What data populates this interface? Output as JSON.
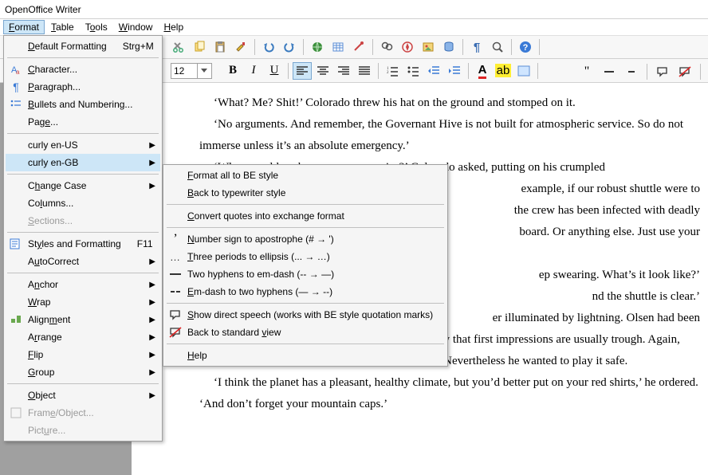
{
  "window": {
    "title": "OpenOffice Writer"
  },
  "menubar": {
    "format": "Format",
    "table": "Table",
    "tools": "Tools",
    "window": "Window",
    "help": "Help"
  },
  "format_bar": {
    "font_size": "12"
  },
  "format_menu": {
    "default_formatting": "Default Formatting",
    "default_formatting_sc": "Strg+M",
    "character": "Character...",
    "paragraph": "Paragraph...",
    "bullets": "Bullets and Numbering...",
    "page": "Page...",
    "curly_us": "curly en-US",
    "curly_gb": "curly en-GB",
    "change_case": "Change Case",
    "columns": "Columns...",
    "sections": "Sections...",
    "styles": "Styles and Formatting",
    "styles_sc": "F11",
    "autocorrect": "AutoCorrect",
    "anchor": "Anchor",
    "wrap": "Wrap",
    "alignment": "Alignment",
    "arrange": "Arrange",
    "flip": "Flip",
    "group": "Group",
    "object": "Object",
    "frame": "Frame/Object...",
    "picture": "Picture..."
  },
  "submenu": {
    "format_be": "Format all to BE style",
    "back_type": "Back to typewriter style",
    "convert_quotes": "Convert quotes into exchange format",
    "number_sign": "Number sign to apostrophe (# → ')",
    "three_periods": "Three periods to ellipsis (... → …)",
    "two_hyphens": "Two hyphens to em-dash (-- → —)",
    "em_to_hyph": "Em-dash to two hyphens (— → --)",
    "show_direct": "Show direct speech (works with BE style quotation marks)",
    "back_std": "Back to standard view",
    "help": "Help"
  },
  "document": {
    "p1": "‘What? Me? Shit!’ Colorado threw his hat on the ground and stomped on it.",
    "p2": "‘No arguments. And remember, the Governant Hive is not built for atmospheric service. So do not immerse unless it’s an absolute emergency.’",
    "p3a": "‘When would such an emergency arise?’ Colorado asked, putting on his crumpled",
    "p3b_suffix": "example, if our robust shuttle were to",
    "p3c_suffix": "the crew has been infected with deadly",
    "p3d_suffix": "board. Or anything else. Just use your",
    "p5_suffix": "ep swearing. What’s it look like?’",
    "p6_suffix": "nd the shuttle is clear.’",
    "p7_prefix_suffix": "er illuminated by lightning. Olsen had been",
    "p7_rest": "studying planetary exploration long enough to know that first impressions are usually trough. Again, one could expect a soft core under the rough shell. Nevertheless he wanted to play it safe.",
    "p8": "‘I think the planet has a pleasant, healthy climate, but you’d better put on your red shirts,’ he ordered. ‘And don’t forget your mountain caps.’"
  }
}
